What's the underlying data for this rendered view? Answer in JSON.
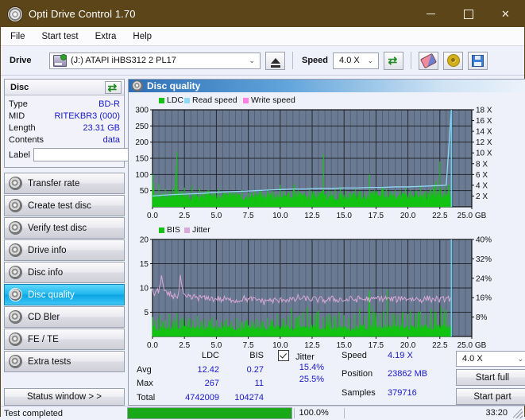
{
  "window": {
    "title": "Opti Drive Control 1.70",
    "icon": "disc-icon",
    "minimize": "–",
    "maximize": "□",
    "close": "✕"
  },
  "menu": {
    "items": [
      "File",
      "Start test",
      "Extra",
      "Help"
    ]
  },
  "toolbar": {
    "drive_label": "Drive",
    "drive_value": "(J:)   ATAPI iHBS312   2 PL17",
    "eject_icon": "eject-icon",
    "speed_label": "Speed",
    "speed_value": "4.0 X",
    "refresh_icon": "refresh-icon",
    "erase_icon": "eraser-icon",
    "settings_icon": "gear-icon",
    "save_icon": "save-icon",
    "arrow": "⌄"
  },
  "disc_panel": {
    "title": "Disc",
    "refresh_icon": "refresh-icon",
    "rows": [
      {
        "key": "Type",
        "value": "BD-R"
      },
      {
        "key": "MID",
        "value": "RITEKBR3 (000)"
      },
      {
        "key": "Length",
        "value": "23.31 GB"
      },
      {
        "key": "Contents",
        "value": "data"
      }
    ],
    "label_key": "Label",
    "label_value": "",
    "label_placeholder": "",
    "disc_icon": "disc-label-icon"
  },
  "sidebar": {
    "items": [
      {
        "label": "Transfer rate",
        "active": false
      },
      {
        "label": "Create test disc",
        "active": false
      },
      {
        "label": "Verify test disc",
        "active": false
      },
      {
        "label": "Drive info",
        "active": false
      },
      {
        "label": "Disc info",
        "active": false
      },
      {
        "label": "Disc quality",
        "active": true
      },
      {
        "label": "CD Bler",
        "active": false
      },
      {
        "label": "FE / TE",
        "active": false
      },
      {
        "label": "Extra tests",
        "active": false
      }
    ],
    "status_window_button": "Status window > >"
  },
  "main": {
    "header_title": "Disc quality",
    "header_icon": "disc-quality-icon"
  },
  "stats": {
    "col_headers": [
      "LDC",
      "BIS"
    ],
    "rows": [
      {
        "name": "Avg",
        "ldc": "12.42",
        "bis": "0.27"
      },
      {
        "name": "Max",
        "ldc": "267",
        "bis": "11"
      },
      {
        "name": "Total",
        "ldc": "4742009",
        "bis": "104274"
      }
    ],
    "jitter_label": "Jitter",
    "jitter_checked": true,
    "jitter_avg": "15.4%",
    "jitter_max": "25.5%",
    "speed_label": "Speed",
    "speed_value": "4.19 X",
    "position_label": "Position",
    "position_value": "23862 MB",
    "samples_label": "Samples",
    "samples_value": "379716",
    "speed_select": "4.0 X",
    "start_full": "Start full",
    "start_part": "Start part"
  },
  "statusbar": {
    "text": "Test completed",
    "progress_percent": "100.0%",
    "progress_value": 100,
    "elapsed": "33:20"
  },
  "colors": {
    "ldc_green": "#12c312",
    "read_speed": "#8fd8f7",
    "write_speed": "#ff80e0",
    "jitter_pink": "#d9a8d9",
    "plot_bg": "#6b7a93",
    "grid": "#3c4352",
    "accent": "#1919c8"
  },
  "chart_data": [
    {
      "type": "area",
      "title": "Disc quality - LDC",
      "legend": [
        "LDC",
        "Read speed",
        "Write speed"
      ],
      "legend_position": "top-left",
      "xlabel": "GB",
      "ylabel": "LDC",
      "y2label": "X",
      "xlim": [
        0.0,
        25.0
      ],
      "ylim": [
        0,
        300
      ],
      "y2lim": [
        0,
        18
      ],
      "xticks": [
        0.0,
        2.5,
        5.0,
        7.5,
        10.0,
        12.5,
        15.0,
        17.5,
        20.0,
        22.5,
        25.0
      ],
      "xtick_labels": [
        "0.0",
        "2.5",
        "5.0",
        "7.5",
        "10.0",
        "12.5",
        "15.0",
        "17.5",
        "20.0",
        "22.5",
        "25.0 GB"
      ],
      "yticks": [
        50,
        100,
        150,
        200,
        250,
        300
      ],
      "y2ticks": [
        2,
        4,
        6,
        8,
        10,
        12,
        14,
        16,
        18
      ],
      "y2tick_labels": [
        "2 X",
        "4 X",
        "6 X",
        "8 X",
        "10 X",
        "12 X",
        "14 X",
        "16 X",
        "18 X"
      ],
      "grid": true,
      "data_end_x": 23.4,
      "series": [
        {
          "name": "LDC",
          "color": "#12c312",
          "x": [
            0.0,
            0.1,
            0.3,
            0.5,
            0.8,
            1.0,
            1.3,
            1.6,
            1.9,
            2.0,
            2.2,
            2.5,
            2.8,
            3.1,
            3.4,
            3.7,
            4.0,
            4.4,
            4.8,
            5.2,
            5.6,
            6.0,
            6.5,
            7.0,
            7.5,
            8.0,
            8.5,
            9.0,
            9.5,
            10.0,
            10.3,
            10.7,
            11.1,
            11.5,
            11.9,
            12.3,
            12.6,
            13.0,
            13.4,
            13.8,
            14.0,
            14.3,
            14.7,
            15.1,
            15.5,
            15.9,
            16.3,
            16.6,
            17.0,
            17.4,
            17.6,
            18.0,
            18.3,
            18.6,
            19.0,
            19.4,
            19.8,
            20.2,
            20.6,
            21.0,
            21.4,
            21.8,
            22.2,
            22.5,
            22.6,
            22.9,
            23.2,
            23.4
          ],
          "values": [
            100,
            55,
            40,
            70,
            42,
            55,
            48,
            60,
            170,
            52,
            46,
            60,
            44,
            66,
            42,
            58,
            46,
            52,
            44,
            56,
            42,
            48,
            46,
            52,
            44,
            50,
            48,
            54,
            46,
            68,
            50,
            46,
            70,
            48,
            44,
            52,
            48,
            46,
            162,
            50,
            48,
            54,
            62,
            50,
            46,
            55,
            48,
            46,
            100,
            52,
            48,
            60,
            54,
            48,
            52,
            50,
            58,
            52,
            48,
            66,
            50,
            54,
            80,
            140,
            58,
            66,
            70,
            55
          ],
          "baseline": 32
        },
        {
          "name": "Read speed",
          "color": "#8fd8f7",
          "x": [
            0.0,
            1.0,
            2.0,
            3.0,
            4.0,
            5.0,
            6.0,
            7.0,
            8.0,
            9.0,
            10.0,
            11.0,
            12.0,
            13.0,
            14.0,
            15.0,
            16.0,
            17.0,
            18.0,
            19.0,
            20.0,
            21.0,
            22.0,
            23.0,
            23.4
          ],
          "values": [
            2.0,
            2.2,
            2.3,
            2.4,
            2.5,
            2.7,
            2.8,
            2.9,
            3.0,
            3.1,
            3.2,
            3.3,
            3.3,
            3.4,
            3.4,
            3.5,
            3.5,
            3.6,
            3.6,
            3.7,
            3.7,
            3.8,
            3.9,
            4.0,
            18.0
          ],
          "axis": "right"
        },
        {
          "name": "Write speed",
          "color": "#ff80e0",
          "x": [],
          "values": []
        }
      ]
    },
    {
      "type": "area",
      "title": "Disc quality - BIS / Jitter",
      "legend": [
        "BIS",
        "Jitter"
      ],
      "legend_position": "top-left",
      "xlabel": "GB",
      "ylabel": "BIS",
      "y2label": "%",
      "xlim": [
        0.0,
        25.0
      ],
      "ylim": [
        0,
        20
      ],
      "y2lim": [
        0,
        40
      ],
      "xticks": [
        0.0,
        2.5,
        5.0,
        7.5,
        10.0,
        12.5,
        15.0,
        17.5,
        20.0,
        22.5,
        25.0
      ],
      "xtick_labels": [
        "0.0",
        "2.5",
        "5.0",
        "7.5",
        "10.0",
        "12.5",
        "15.0",
        "17.5",
        "20.0",
        "22.5",
        "25.0 GB"
      ],
      "yticks": [
        5,
        10,
        15,
        20
      ],
      "y2ticks": [
        8,
        16,
        24,
        32,
        40
      ],
      "y2tick_labels": [
        "8%",
        "16%",
        "24%",
        "32%",
        "40%"
      ],
      "grid": true,
      "data_end_x": 23.4,
      "series": [
        {
          "name": "BIS",
          "color": "#12c312",
          "x": [
            0.0,
            0.2,
            0.4,
            0.6,
            0.8,
            1.0,
            1.3,
            1.6,
            1.9,
            2.2,
            2.4,
            2.6,
            2.9,
            3.2,
            3.5,
            3.8,
            4.1,
            4.4,
            4.7,
            5.0,
            5.4,
            5.8,
            6.2,
            6.6,
            7.0,
            7.4,
            7.8,
            8.2,
            8.6,
            9.0,
            9.4,
            9.8,
            10.2,
            10.6,
            10.9,
            11.2,
            11.5,
            11.8,
            12.1,
            12.4,
            12.7,
            13.0,
            13.4,
            13.8,
            14.2,
            14.6,
            15.0,
            15.4,
            15.8,
            16.2,
            16.6,
            17.0,
            17.4,
            17.8,
            18.1,
            18.4,
            18.8,
            19.2,
            19.6,
            20.0,
            20.2,
            20.6,
            21.0,
            21.4,
            21.8,
            22.2,
            22.6,
            23.0,
            23.4
          ],
          "values": [
            4.0,
            3.2,
            3.6,
            4.4,
            3.0,
            3.4,
            4.6,
            3.2,
            4.8,
            3.4,
            4.0,
            3.2,
            3.8,
            3.4,
            4.2,
            3.0,
            3.6,
            3.2,
            4.0,
            3.4,
            3.0,
            3.6,
            3.2,
            3.8,
            3.0,
            3.4,
            3.2,
            3.6,
            3.0,
            3.8,
            3.4,
            4.6,
            3.6,
            4.2,
            5.8,
            3.8,
            4.4,
            5.0,
            6.0,
            4.2,
            4.8,
            5.4,
            4.0,
            4.6,
            4.2,
            5.0,
            4.4,
            3.8,
            4.6,
            5.8,
            4.2,
            9.5,
            5.0,
            4.6,
            5.2,
            9.6,
            4.8,
            4.4,
            5.0,
            4.6,
            5.4,
            4.8,
            5.2,
            4.6,
            5.8,
            5.0,
            6.2,
            5.4,
            5.0
          ],
          "baseline": 1.6
        },
        {
          "name": "Jitter",
          "color": "#d9a8d9",
          "axis": "right",
          "x": [
            0.0,
            0.15,
            0.3,
            0.5,
            0.7,
            0.85,
            1.0,
            1.2,
            1.4,
            1.6,
            1.8,
            2.0,
            2.2,
            2.4,
            2.5,
            2.7,
            2.9,
            3.1,
            3.3,
            3.6,
            3.9,
            4.2,
            4.5,
            4.8,
            5.1,
            5.4,
            5.7,
            6.0,
            6.3,
            6.6,
            6.9,
            7.2,
            7.5,
            7.8,
            8.1,
            8.4,
            8.7,
            9.0,
            9.3,
            9.6,
            9.9,
            10.2,
            10.5,
            10.8,
            11.1,
            11.4,
            11.7,
            12.0,
            12.3,
            12.6,
            12.9,
            13.2,
            13.5,
            13.8,
            14.1,
            14.4,
            14.7,
            15.0,
            15.3,
            15.6,
            15.9,
            16.2,
            16.5,
            16.8,
            17.1,
            17.4,
            17.7,
            18.0,
            18.3,
            18.6,
            18.9,
            19.2,
            19.5,
            19.8,
            20.1,
            20.4,
            20.7,
            21.0,
            21.3,
            21.6,
            21.9,
            22.2,
            22.5,
            22.8,
            23.1,
            23.4
          ],
          "values": [
            18.8,
            17.4,
            19.0,
            18.2,
            25.5,
            20.0,
            18.0,
            17.0,
            17.6,
            16.4,
            17.2,
            16.2,
            24.8,
            17.0,
            16.4,
            15.6,
            16.8,
            15.4,
            16.6,
            15.8,
            16.2,
            15.4,
            16.0,
            15.2,
            15.8,
            15.0,
            15.6,
            14.8,
            15.4,
            14.6,
            15.2,
            15.8,
            15.0,
            15.6,
            14.8,
            15.4,
            14.0,
            15.2,
            14.6,
            15.0,
            14.4,
            15.6,
            15.0,
            15.4,
            14.8,
            16.2,
            15.4,
            15.8,
            15.2,
            15.6,
            15.0,
            15.4,
            14.8,
            15.2,
            15.6,
            15.0,
            15.4,
            14.8,
            15.2,
            15.6,
            15.0,
            15.8,
            15.2,
            15.6,
            15.0,
            15.4,
            16.0,
            15.4,
            15.8,
            15.2,
            15.6,
            15.0,
            16.2,
            15.4,
            15.8,
            15.2,
            15.6,
            15.0,
            15.4,
            15.8,
            15.2,
            15.6,
            15.0,
            15.4,
            15.8,
            15.2
          ]
        }
      ]
    }
  ]
}
